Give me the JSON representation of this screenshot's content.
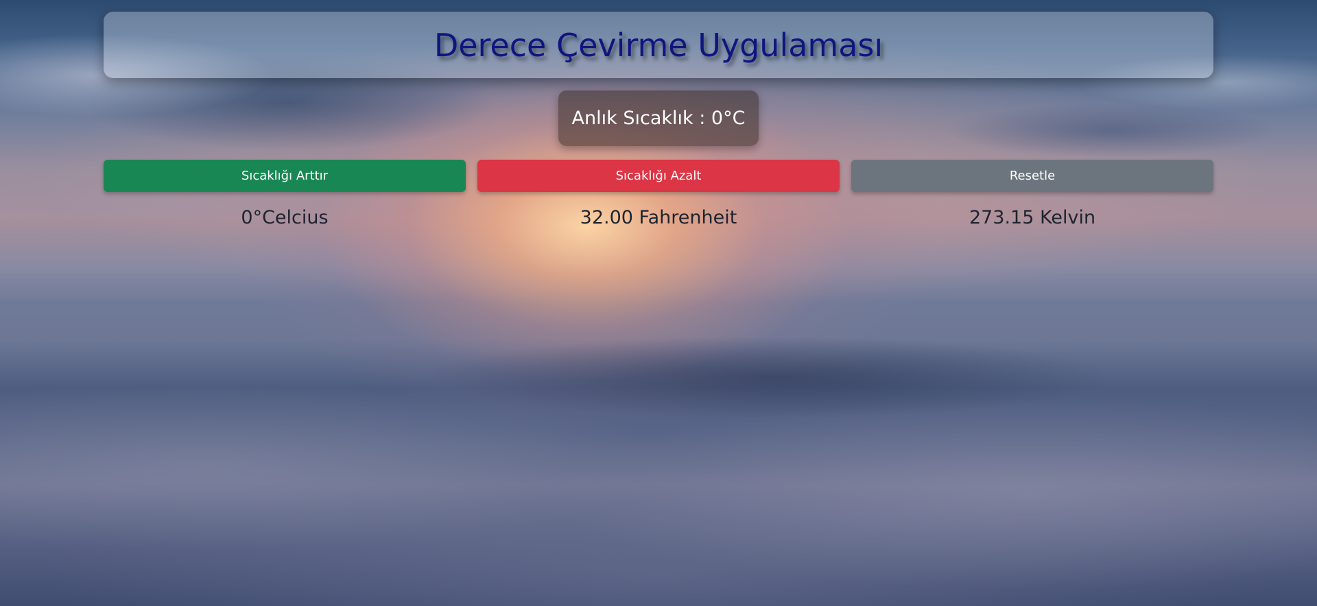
{
  "header": {
    "title": "Derece Çevirme Uygulaması"
  },
  "current_temp": {
    "label": "Anlık Sıcaklık : 0°C"
  },
  "buttons": {
    "increase_label": "Sıcaklığı Arttır",
    "decrease_label": "Sıcaklığı Azalt",
    "reset_label": "Resetle"
  },
  "results": {
    "celsius": "0°Celcius",
    "fahrenheit": "32.00 Fahrenheit",
    "kelvin": "273.15 Kelvin"
  },
  "colors": {
    "title": "#0f1580",
    "increase_button": "#198754",
    "decrease_button": "#dc3545",
    "reset_button": "#6c757d"
  }
}
